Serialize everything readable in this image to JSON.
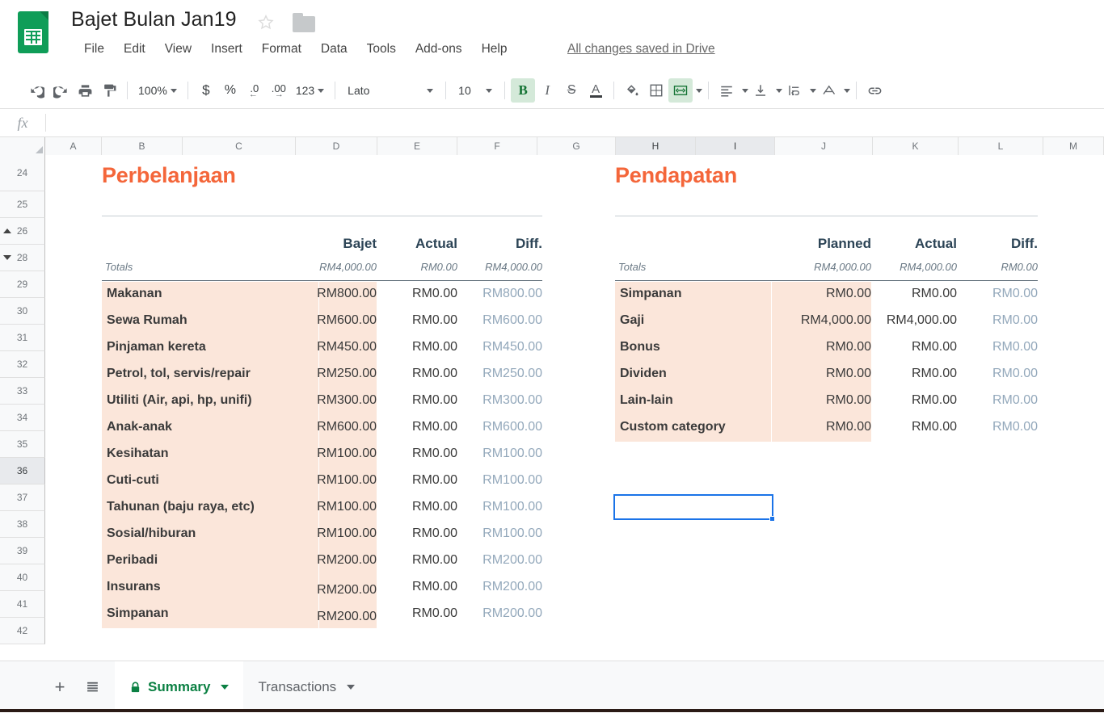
{
  "app": {
    "doc_title": "Bajet Bulan Jan19",
    "save_state": "All changes saved in Drive",
    "logo_icon": "sheets-logo-icon",
    "star_icon": "star-icon",
    "folder_icon": "folder-icon"
  },
  "menus": [
    "File",
    "Edit",
    "View",
    "Insert",
    "Format",
    "Data",
    "Tools",
    "Add-ons",
    "Help"
  ],
  "toolbar": {
    "undo_icon": "undo-icon",
    "redo_icon": "redo-icon",
    "print_icon": "print-icon",
    "paint_format_icon": "paint-format-icon",
    "zoom_value": "100%",
    "currency_label": "$",
    "percent_label": "%",
    "decrease_decimal_label": ".0",
    "increase_decimal_label": ".00",
    "number_format_label": "123",
    "font_family_value": "Lato",
    "font_size_value": "10",
    "bold_label": "B",
    "italic_label": "I",
    "strikethrough_label": "S",
    "text_color_label": "A",
    "fill_color_icon": "fill-color-icon",
    "borders_icon": "borders-icon",
    "merge_cells_icon": "merge-cells-icon",
    "horizontal_align_icon": "horizontal-align-icon",
    "vertical_align_icon": "vertical-align-icon",
    "text_wrap_icon": "text-wrap-icon",
    "text_rotation_icon": "text-rotation-icon",
    "link_icon": "link-icon"
  },
  "formula_bar": {
    "fx_label": "fx",
    "value": ""
  },
  "grid": {
    "columns": [
      "A",
      "B",
      "C",
      "D",
      "E",
      "F",
      "G",
      "H",
      "I",
      "J",
      "K",
      "L",
      "M"
    ],
    "selected_columns": [
      "H",
      "I"
    ],
    "rows": [
      "24",
      "25",
      "26",
      "28",
      "29",
      "30",
      "31",
      "32",
      "33",
      "34",
      "35",
      "36",
      "37",
      "38",
      "39",
      "40",
      "41",
      "42"
    ],
    "selected_row": "36",
    "collapse_row": "26",
    "expand_row": "28",
    "selected_cell": "H36"
  },
  "expenses": {
    "title": "Perbelanjaan",
    "headers": [
      "Bajet",
      "Actual",
      "Diff."
    ],
    "totals_label": "Totals",
    "totals": [
      "RM4,000.00",
      "RM0.00",
      "RM4,000.00"
    ],
    "rows": [
      {
        "name": "Makanan",
        "planned": "RM800.00",
        "actual": "RM0.00",
        "diff": "RM800.00"
      },
      {
        "name": "Sewa Rumah",
        "planned": "RM600.00",
        "actual": "RM0.00",
        "diff": "RM600.00"
      },
      {
        "name": "Pinjaman kereta",
        "planned": "RM450.00",
        "actual": "RM0.00",
        "diff": "RM450.00"
      },
      {
        "name": "Petrol, tol, servis/repair",
        "planned": "RM250.00",
        "actual": "RM0.00",
        "diff": "RM250.00"
      },
      {
        "name": "Utiliti (Air, api, hp, unifi)",
        "planned": "RM300.00",
        "actual": "RM0.00",
        "diff": "RM300.00"
      },
      {
        "name": "Anak-anak",
        "planned": "RM600.00",
        "actual": "RM0.00",
        "diff": "RM600.00"
      },
      {
        "name": "Kesihatan",
        "planned": "RM100.00",
        "actual": "RM0.00",
        "diff": "RM100.00"
      },
      {
        "name": "Cuti-cuti",
        "planned": "RM100.00",
        "actual": "RM0.00",
        "diff": "RM100.00"
      },
      {
        "name": "Tahunan (baju raya, etc)",
        "planned": "RM100.00",
        "actual": "RM0.00",
        "diff": "RM100.00"
      },
      {
        "name": "Sosial/hiburan",
        "planned": "RM100.00",
        "actual": "RM0.00",
        "diff": "RM100.00"
      },
      {
        "name": "Peribadi",
        "planned": "RM200.00",
        "actual": "RM0.00",
        "diff": "RM200.00"
      },
      {
        "name": "Insurans",
        "planned": "RM200.00",
        "actual": "RM0.00",
        "diff": "RM200.00"
      },
      {
        "name": "Simpanan",
        "planned": "RM200.00",
        "actual": "RM0.00",
        "diff": "RM200.00"
      }
    ]
  },
  "income": {
    "title": "Pendapatan",
    "headers": [
      "Planned",
      "Actual",
      "Diff."
    ],
    "totals_label": "Totals",
    "totals": [
      "RM4,000.00",
      "RM4,000.00",
      "RM0.00"
    ],
    "rows": [
      {
        "name": "Simpanan",
        "planned": "RM0.00",
        "actual": "RM0.00",
        "diff": "RM0.00"
      },
      {
        "name": "Gaji",
        "planned": "RM4,000.00",
        "actual": "RM4,000.00",
        "diff": "RM0.00"
      },
      {
        "name": "Bonus",
        "planned": "RM0.00",
        "actual": "RM0.00",
        "diff": "RM0.00"
      },
      {
        "name": "Dividen",
        "planned": "RM0.00",
        "actual": "RM0.00",
        "diff": "RM0.00"
      },
      {
        "name": "Lain-lain",
        "planned": "RM0.00",
        "actual": "RM0.00",
        "diff": "RM0.00"
      },
      {
        "name": "Custom category",
        "planned": "RM0.00",
        "actual": "RM0.00",
        "diff": "RM0.00"
      }
    ]
  },
  "sheet_tabs": {
    "add_sheet_icon": "add-sheet-icon",
    "all_sheets_icon": "all-sheets-icon",
    "tabs": [
      {
        "label": "Summary",
        "active": true,
        "locked": true
      },
      {
        "label": "Transactions",
        "active": false,
        "locked": false
      }
    ]
  },
  "colors": {
    "accent_orange": "#f4663a",
    "row_band": "#fbe6da",
    "diff_text": "#93a8bb",
    "header_text": "#2c4456",
    "sheets_green": "#0f9d58",
    "selection_blue": "#1a73e8"
  }
}
